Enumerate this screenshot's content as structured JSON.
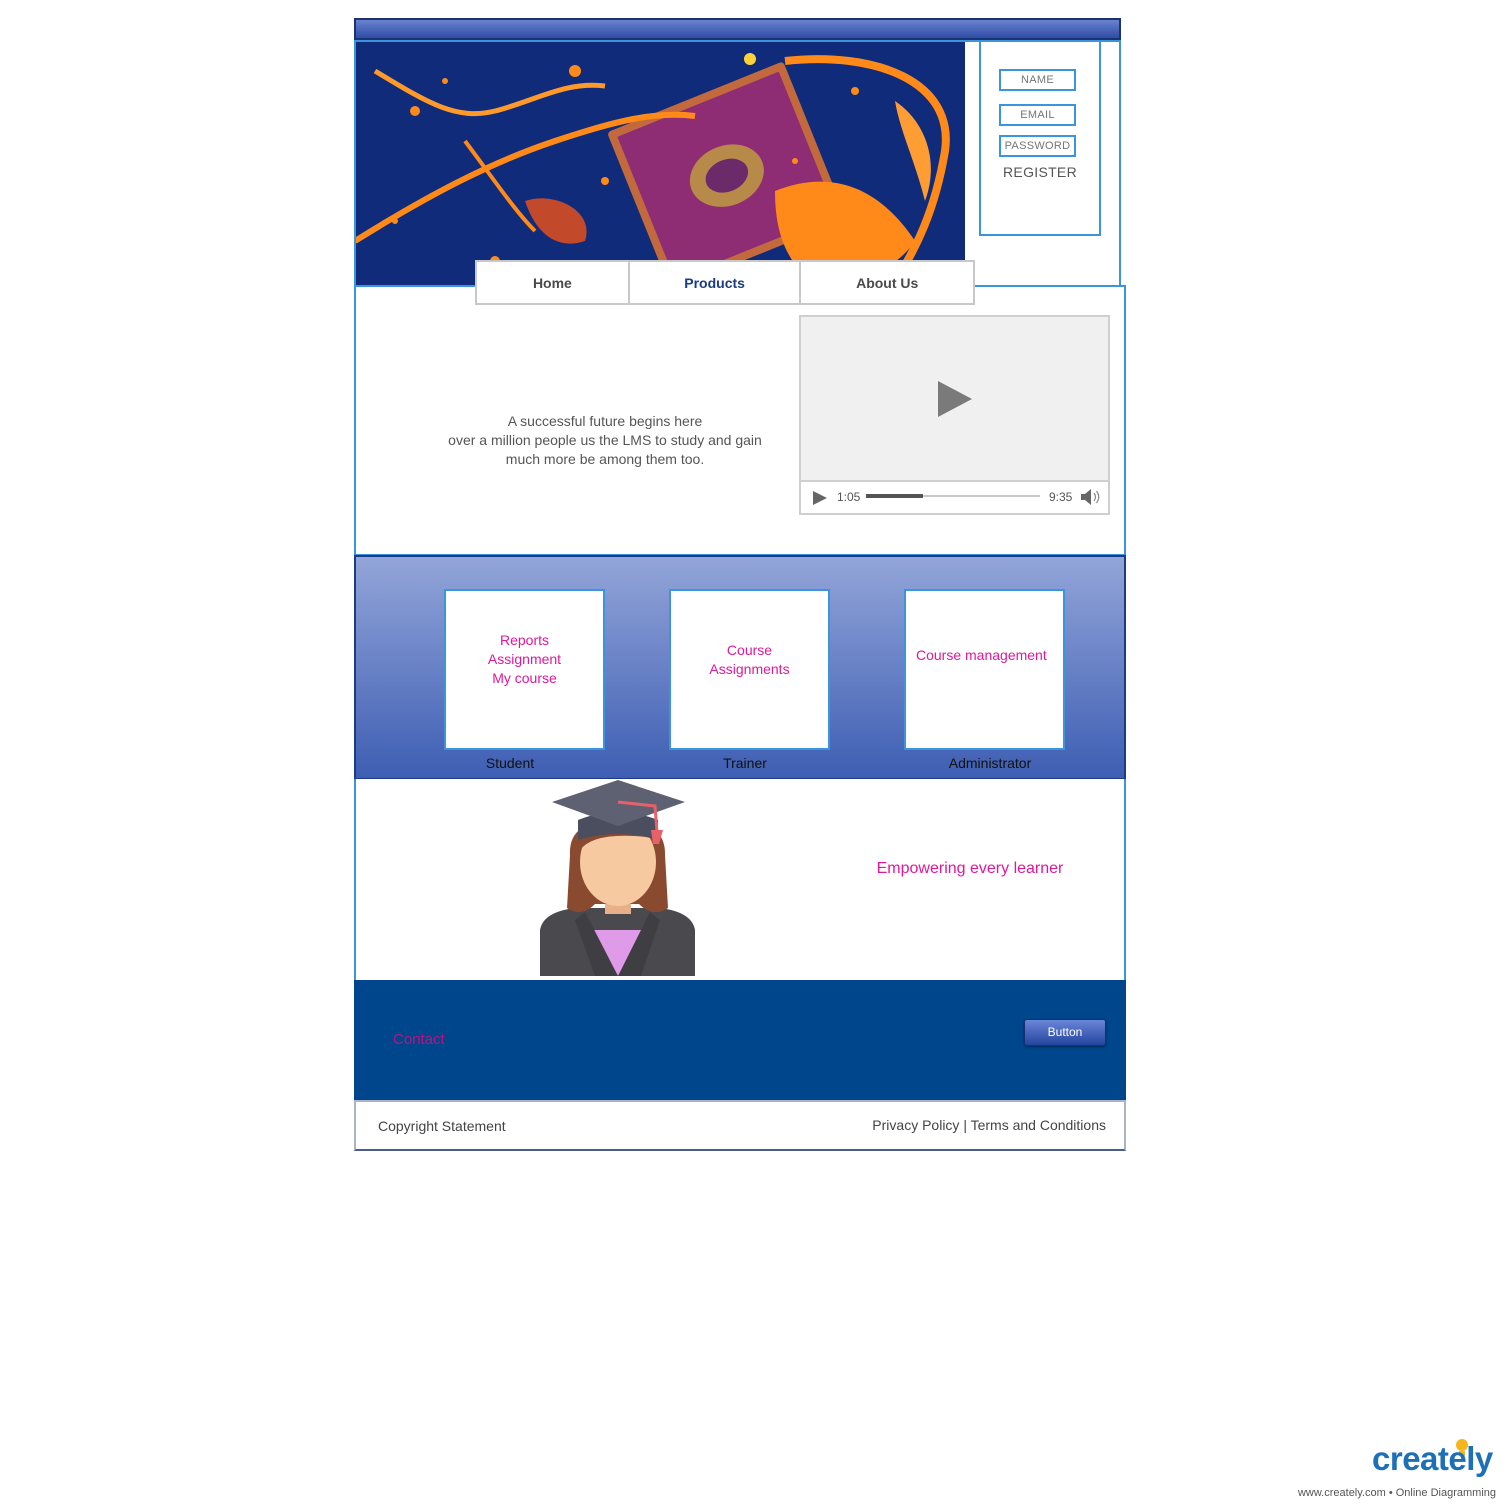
{
  "register": {
    "name_placeholder": "NAME",
    "email_placeholder": "EMAIL",
    "password_placeholder": "PASSWORD",
    "register_label": "REGISTER"
  },
  "nav": {
    "items": [
      {
        "label": "Home"
      },
      {
        "label": "Products"
      },
      {
        "label": "About Us"
      }
    ],
    "active": "Products"
  },
  "intro": {
    "line1": "A successful future begins here",
    "line2": "over a million people us the LMS to study and gain",
    "line3": "much more be among them too."
  },
  "video": {
    "current_time": "1:05",
    "duration": "9:35",
    "progress_fraction": 0.33,
    "icons": [
      "play-icon",
      "volume-icon"
    ]
  },
  "roles": [
    {
      "label": "Student",
      "items": [
        "Reports",
        "Assignment",
        "My course"
      ]
    },
    {
      "label": "Trainer",
      "items": [
        "Course",
        "Assignments"
      ]
    },
    {
      "label": "Administrator",
      "items": [
        "Course management"
      ]
    }
  ],
  "learner": {
    "tagline": "Empowering every learner"
  },
  "footer": {
    "contact_label": "Contact",
    "button_label": "Button",
    "copyright": "Copyright Statement",
    "policy": "Privacy Policy | Terms and Conditions"
  },
  "watermark": {
    "logo": "creately",
    "subtitle": "www.creately.com • Online Diagramming"
  },
  "colors": {
    "accent_blue": "#3b95dc",
    "header_navy": "#1d3272",
    "footer_navy": "#00468c",
    "magenta": "#e0189a"
  }
}
